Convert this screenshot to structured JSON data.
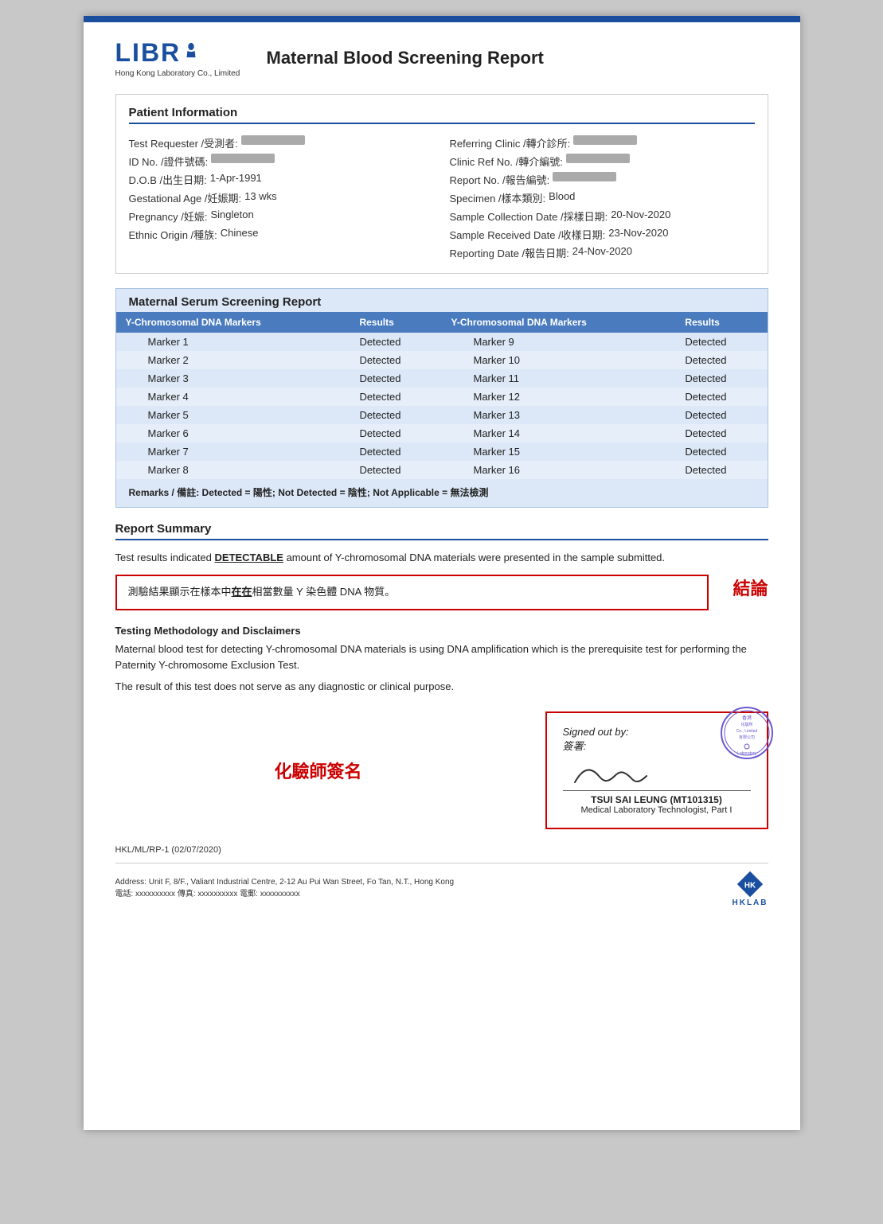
{
  "header": {
    "logo_name": "LIBRA",
    "logo_subtitle": "Hong Kong Laboratory Co., Limited",
    "report_title": "Maternal Blood Screening Report"
  },
  "patient_info": {
    "section_title": "Patient Information",
    "left_fields": [
      {
        "label": "Test Requester /受測者:",
        "value": "REDACTED"
      },
      {
        "label": "ID No. /證件號碼:",
        "value": "REDACTED"
      },
      {
        "label": "D.O.B /出生日期:",
        "value": "1-Apr-1991"
      },
      {
        "label": "Gestational Age /妊娠期:",
        "value": "13 wks"
      },
      {
        "label": "Pregnancy /妊娠:",
        "value": "Singleton"
      },
      {
        "label": "Ethnic Origin /種族:",
        "value": "Chinese"
      }
    ],
    "right_fields": [
      {
        "label": "Referring Clinic /轉介診所:",
        "value": "REDACTED"
      },
      {
        "label": "Clinic Ref No. /轉介編號:",
        "value": "REDACTED"
      },
      {
        "label": "Report No. /報告編號:",
        "value": "REDACTED"
      },
      {
        "label": "Specimen /樣本類別:",
        "value": "Blood"
      },
      {
        "label": "Sample Collection Date /採樣日期:",
        "value": "20-Nov-2020"
      },
      {
        "label": "Sample Received Date /收樣日期:",
        "value": "23-Nov-2020"
      },
      {
        "label": "Reporting Date /報告日期:",
        "value": "24-Nov-2020"
      }
    ]
  },
  "screening": {
    "section_title": "Maternal Serum Screening Report",
    "col1_header": "Y-Chromosomal DNA Markers",
    "col2_header": "Results",
    "col3_header": "Y-Chromosomal DNA Markers",
    "col4_header": "Results",
    "left_markers": [
      {
        "name": "Marker 1",
        "result": "Detected"
      },
      {
        "name": "Marker 2",
        "result": "Detected"
      },
      {
        "name": "Marker 3",
        "result": "Detected"
      },
      {
        "name": "Marker 4",
        "result": "Detected"
      },
      {
        "name": "Marker 5",
        "result": "Detected"
      },
      {
        "name": "Marker 6",
        "result": "Detected"
      },
      {
        "name": "Marker 7",
        "result": "Detected"
      },
      {
        "name": "Marker 8",
        "result": "Detected"
      }
    ],
    "right_markers": [
      {
        "name": "Marker 9",
        "result": "Detected"
      },
      {
        "name": "Marker 10",
        "result": "Detected"
      },
      {
        "name": "Marker 11",
        "result": "Detected"
      },
      {
        "name": "Marker 12",
        "result": "Detected"
      },
      {
        "name": "Marker 13",
        "result": "Detected"
      },
      {
        "name": "Marker 14",
        "result": "Detected"
      },
      {
        "name": "Marker 15",
        "result": "Detected"
      },
      {
        "name": "Marker 16",
        "result": "Detected"
      }
    ],
    "remarks": "Remarks / 備註: Detected = 陽性; Not Detected = 陰性; Not Applicable = 無法檢測"
  },
  "summary": {
    "section_title": "Report Summary",
    "text_before": "Test results indicated ",
    "detectable_word": "DETECTABLE",
    "text_after": " amount of Y-chromosomal DNA materials were presented in the sample submitted.",
    "chinese_text_before": "測驗結果顯示在樣本中",
    "chinese_underline": "在在",
    "chinese_text_after": "相當數量 Y 染色體 DNA 物質。",
    "conclusion_label": "結論"
  },
  "methodology": {
    "title": "Testing Methodology and Disclaimers",
    "text1": "Maternal blood test for detecting Y-chromosomal DNA materials is using DNA amplification which is the prerequisite test for performing the Paternity Y-chromosome Exclusion Test.",
    "text2": "The result of this test does not serve as any diagnostic or clinical purpose."
  },
  "signature": {
    "chemist_label": "化驗師簽名",
    "signed_by_en": "Signed out by:",
    "signed_by_zh": "簽署:",
    "signer_name": "TSUI SAI LEUNG (MT101315)",
    "signer_title": "Medical Laboratory Technologist, Part I"
  },
  "footer": {
    "ref": "HKL/ML/RP-1 (02/07/2020)",
    "address": "Address: Unit F, 8/F., Valiant Industrial Centre, 2-12 Au Pui Wan Street, Fo Tan, N.T., Hong Kong",
    "contacts": "電話: xxxxxxxxxx    傳真: xxxxxxxxxx    電郵: xxxxxxxxxx",
    "hklab": "HKLAB"
  }
}
